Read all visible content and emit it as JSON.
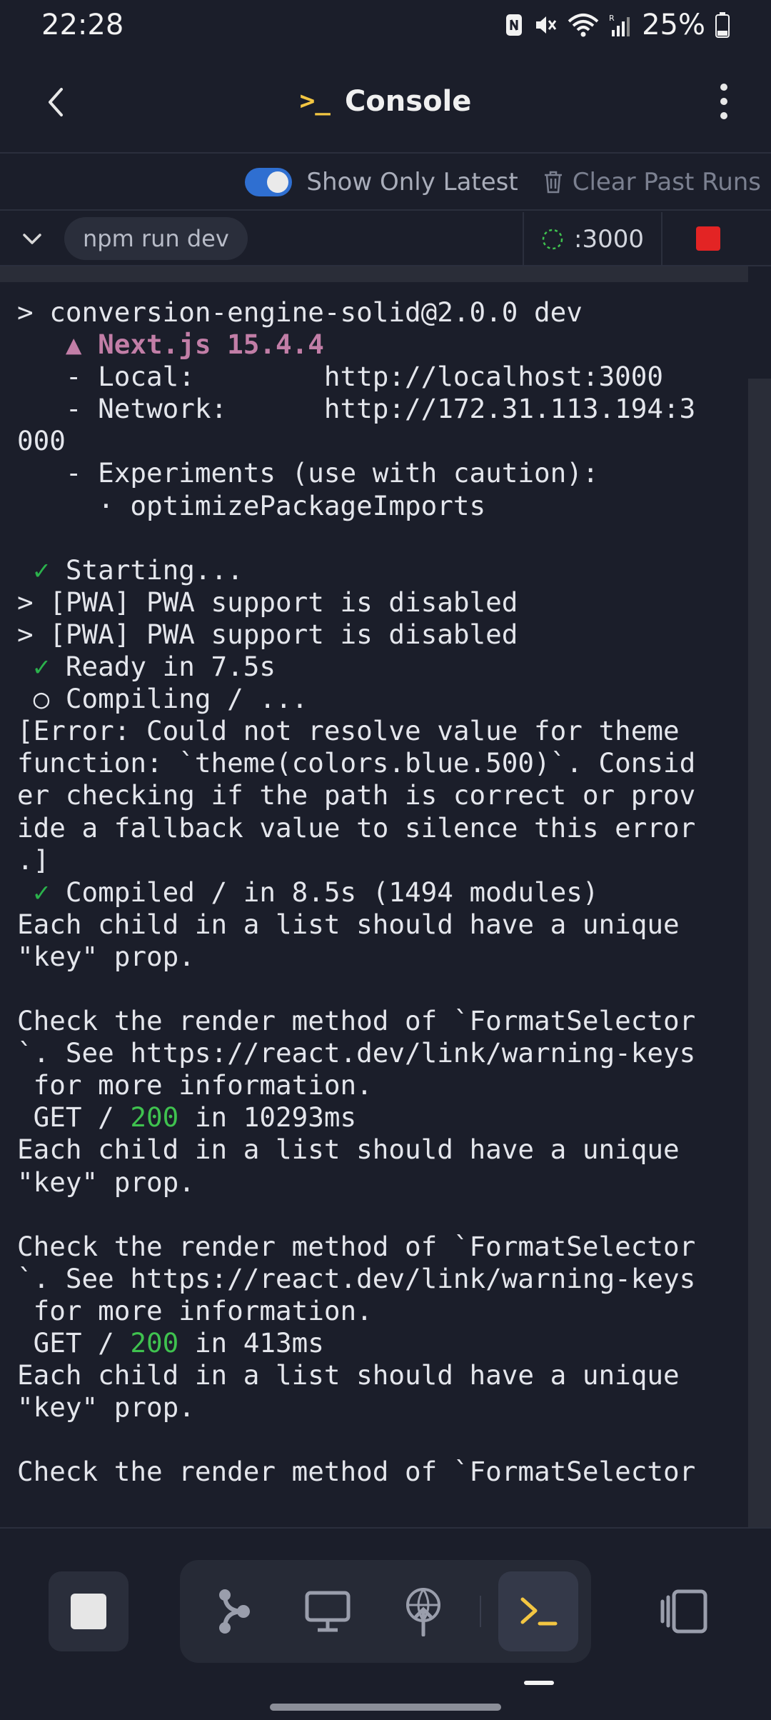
{
  "status_bar": {
    "time": "22:28",
    "battery": "25%",
    "icons": [
      "nfc-icon",
      "mute-icon",
      "wifi-icon",
      "signal-icon",
      "battery-icon"
    ]
  },
  "header": {
    "title": "Console",
    "title_glyph": ">_",
    "icons": [
      "back-icon",
      "more-vertical-icon"
    ]
  },
  "toolbar": {
    "toggle_label": "Show Only Latest",
    "toggle_on": true,
    "clear_label": "Clear Past Runs"
  },
  "process": {
    "command": "npm run dev",
    "port": ":3000",
    "status_color": "#e32424"
  },
  "console": {
    "lines": [
      {
        "t": "> conversion-engine-solid@2.0.0 dev"
      },
      {
        "t": "   ▲ Next.js 15.4.4",
        "c": "next"
      },
      {
        "t": "   - Local:        http://localhost:3000"
      },
      {
        "t": "   - Network:      http://172.31.113.194:3"
      },
      {
        "t": "000"
      },
      {
        "t": "   - Experiments (use with caution):"
      },
      {
        "t": "     · optimizePackageImports"
      },
      {
        "t": ""
      },
      {
        "t": " ✓ Starting...",
        "c": "check"
      },
      {
        "t": "> [PWA] PWA support is disabled"
      },
      {
        "t": "> [PWA] PWA support is disabled"
      },
      {
        "t": " ✓ Ready in 7.5s",
        "c": "check"
      },
      {
        "t": " ○ Compiling / ..."
      },
      {
        "t": "[Error: Could not resolve value for theme"
      },
      {
        "t": "function: `theme(colors.blue.500)`. Consid"
      },
      {
        "t": "er checking if the path is correct or prov"
      },
      {
        "t": "ide a fallback value to silence this error"
      },
      {
        "t": ".]"
      },
      {
        "t": " ✓ Compiled / in 8.5s (1494 modules)",
        "c": "check"
      },
      {
        "t": "Each child in a list should have a unique"
      },
      {
        "t": "\"key\" prop."
      },
      {
        "t": ""
      },
      {
        "t": "Check the render method of `FormatSelector"
      },
      {
        "t": "`. See https://react.dev/link/warning-keys"
      },
      {
        "t": " for more information."
      },
      {
        "t": " GET / 200 in 10293ms",
        "c": "get"
      },
      {
        "t": "Each child in a list should have a unique"
      },
      {
        "t": "\"key\" prop."
      },
      {
        "t": ""
      },
      {
        "t": "Check the render method of `FormatSelector"
      },
      {
        "t": "`. See https://react.dev/link/warning-keys"
      },
      {
        "t": " for more information."
      },
      {
        "t": " GET / 200 in 413ms",
        "c": "get"
      },
      {
        "t": "Each child in a list should have a unique"
      },
      {
        "t": "\"key\" prop."
      },
      {
        "t": ""
      },
      {
        "t": "Check the render method of `FormatSelector"
      }
    ]
  },
  "bottom_nav": {
    "items": [
      "stop-icon",
      "git-branch-icon",
      "monitor-icon",
      "deploy-icon",
      "terminal-icon",
      "panel-icon"
    ],
    "active": "terminal-icon"
  },
  "colors": {
    "background": "#1b1e2a",
    "accent_yellow": "#f3c642",
    "toggle_blue": "#2f6fd1",
    "success_green": "#2bb24c",
    "next_pink": "#c27ea7"
  }
}
